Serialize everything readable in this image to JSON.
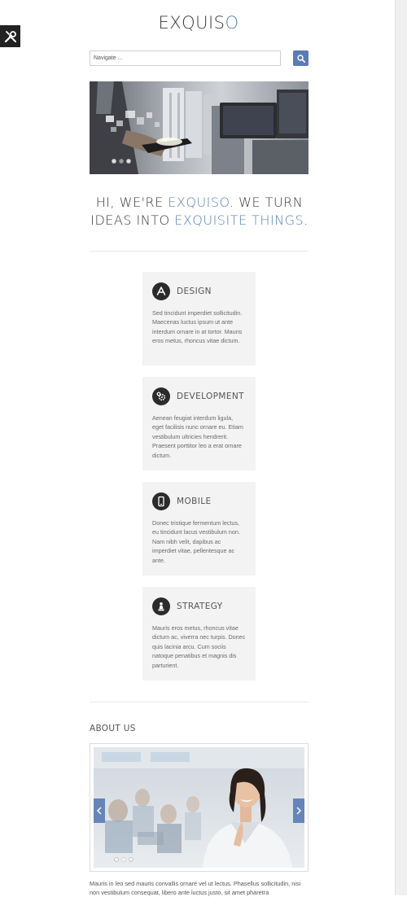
{
  "brand": {
    "name_part1": "EXQUIS",
    "name_part2": "O"
  },
  "nav": {
    "placeholder": "Navigate ..."
  },
  "tagline": {
    "line1_a": "HI, WE'RE ",
    "line1_b": "EXQUISO",
    "line1_c": ". WE TURN",
    "line2_a": "IDEAS INTO ",
    "line2_b": "EXQUISITE THINGS",
    "line2_c": "."
  },
  "services": [
    {
      "title": "DESIGN",
      "icon": "app-store-icon",
      "text": "Sed tincidunt imperdiet sollicitudin. Maecenas luctus ipsum ut ante interdum ornare in at tortor. Mauris eros metus, rhoncus vitae dictum."
    },
    {
      "title": "DEVELOPMENT",
      "icon": "gears-icon",
      "text": "Aenean feugiat interdum ligula, eget facilisis nunc ornare eu. Etiam vestibulum ultricies hendrerit. Praesent porttitor leo a erat ornare dictum."
    },
    {
      "title": "MOBILE",
      "icon": "smartphone-icon",
      "text": "Donec tristique fermentum lectus, eu tincidunt lacus vestibulum non. Nam nibh velit, dapibus ac imperdiet vitae, pellentesque ac ante."
    },
    {
      "title": "STRATEGY",
      "icon": "chess-pawn-icon",
      "text": "Mauris eros metus, rhoncus vitae dictum ac, viverra nec turpis. Donec quis lacinia arcu. Cum sociis natoque penatibus et magnis dis parturient."
    }
  ],
  "about": {
    "title": "ABOUT US",
    "text": "Mauris in leo sed mauris convallis ornare vel ut lectus. Phasellus sollicitudin, nisi non vestibulum consequat, libero ante luctus justo, sit amet pharetra"
  },
  "colors": {
    "accent": "#5f80b4",
    "button": "#5a7bb3",
    "card_bg": "#f3f3f3",
    "icon_bg": "#2b2b2b"
  }
}
